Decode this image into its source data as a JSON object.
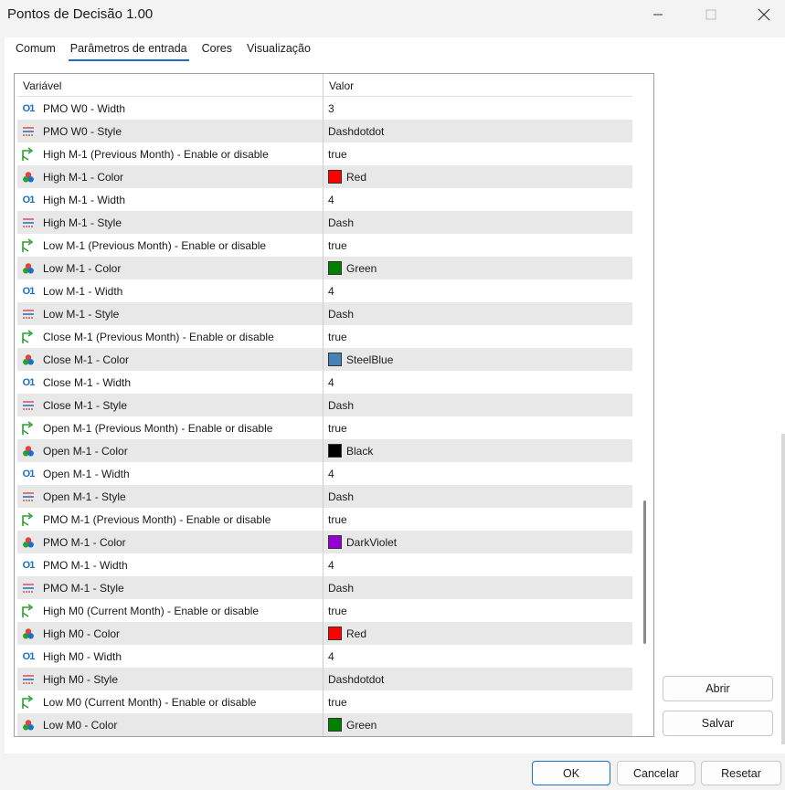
{
  "window": {
    "title": "Pontos de Decisão 1.00"
  },
  "tabs": [
    {
      "label": "Comum"
    },
    {
      "label": "Parâmetros de entrada"
    },
    {
      "label": "Cores"
    },
    {
      "label": "Visualização"
    }
  ],
  "table": {
    "headers": {
      "variable": "Variável",
      "value": "Valor"
    },
    "rows": [
      {
        "icon": "int",
        "name": "PMO W0 - Width",
        "value": "3"
      },
      {
        "icon": "style",
        "name": "PMO W0 - Style",
        "value": "Dashdotdot"
      },
      {
        "icon": "bool",
        "name": "High M-1 (Previous Month) - Enable or disable",
        "value": "true"
      },
      {
        "icon": "color",
        "name": "High M-1 - Color",
        "value": "Red",
        "swatch": "#ff0000"
      },
      {
        "icon": "int",
        "name": "High M-1 - Width",
        "value": "4"
      },
      {
        "icon": "style",
        "name": "High M-1 - Style",
        "value": "Dash"
      },
      {
        "icon": "bool",
        "name": "Low M-1 (Previous Month) - Enable or disable",
        "value": "true"
      },
      {
        "icon": "color",
        "name": "Low M-1 - Color",
        "value": "Green",
        "swatch": "#008000"
      },
      {
        "icon": "int",
        "name": "Low M-1 - Width",
        "value": "4"
      },
      {
        "icon": "style",
        "name": "Low M-1 - Style",
        "value": "Dash"
      },
      {
        "icon": "bool",
        "name": "Close M-1 (Previous Month) - Enable or disable",
        "value": "true"
      },
      {
        "icon": "color",
        "name": "Close M-1 - Color",
        "value": "SteelBlue",
        "swatch": "#4682b4"
      },
      {
        "icon": "int",
        "name": "Close M-1 - Width",
        "value": "4"
      },
      {
        "icon": "style",
        "name": "Close M-1 - Style",
        "value": "Dash"
      },
      {
        "icon": "bool",
        "name": "Open M-1 (Previous Month) - Enable or disable",
        "value": "true"
      },
      {
        "icon": "color",
        "name": "Open M-1 - Color",
        "value": "Black",
        "swatch": "#000000"
      },
      {
        "icon": "int",
        "name": "Open M-1 - Width",
        "value": "4"
      },
      {
        "icon": "style",
        "name": "Open M-1 - Style",
        "value": "Dash"
      },
      {
        "icon": "bool",
        "name": "PMO M-1 (Previous Month) - Enable or disable",
        "value": "true"
      },
      {
        "icon": "color",
        "name": "PMO M-1 - Color",
        "value": "DarkViolet",
        "swatch": "#9400d3"
      },
      {
        "icon": "int",
        "name": "PMO M-1 - Width",
        "value": "4"
      },
      {
        "icon": "style",
        "name": "PMO M-1 - Style",
        "value": "Dash"
      },
      {
        "icon": "bool",
        "name": "High M0 (Current Month) - Enable or disable",
        "value": "true"
      },
      {
        "icon": "color",
        "name": "High M0 - Color",
        "value": "Red",
        "swatch": "#ff0000"
      },
      {
        "icon": "int",
        "name": "High M0 - Width",
        "value": "4"
      },
      {
        "icon": "style",
        "name": "High M0 - Style",
        "value": "Dashdotdot"
      },
      {
        "icon": "bool",
        "name": "Low M0 (Current Month) - Enable or disable",
        "value": "true"
      },
      {
        "icon": "color",
        "name": "Low M0 - Color",
        "value": "Green",
        "swatch": "#008000"
      }
    ]
  },
  "side_buttons": {
    "open": "Abrir",
    "save": "Salvar"
  },
  "footer_buttons": {
    "ok": "OK",
    "cancel": "Cancelar",
    "reset": "Resetar"
  },
  "colors": {
    "accent": "#1a6fc7",
    "row_alt": "#e8e8e8"
  }
}
